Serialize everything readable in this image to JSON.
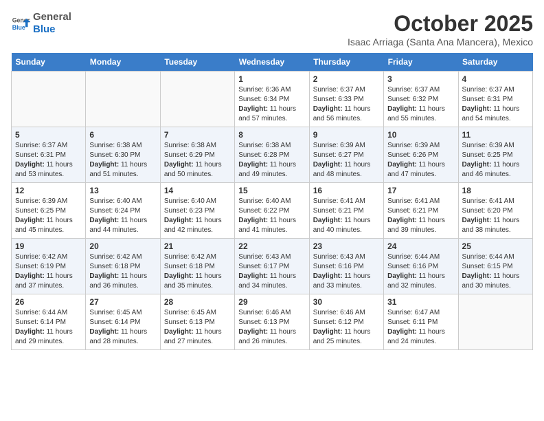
{
  "header": {
    "logo_line1": "General",
    "logo_line2": "Blue",
    "month": "October 2025",
    "location": "Isaac Arriaga (Santa Ana Mancera), Mexico"
  },
  "days_of_week": [
    "Sunday",
    "Monday",
    "Tuesday",
    "Wednesday",
    "Thursday",
    "Friday",
    "Saturday"
  ],
  "weeks": [
    [
      {
        "day": "",
        "content": ""
      },
      {
        "day": "",
        "content": ""
      },
      {
        "day": "",
        "content": ""
      },
      {
        "day": "1",
        "content": "Sunrise: 6:36 AM\nSunset: 6:34 PM\nDaylight: 11 hours and 57 minutes."
      },
      {
        "day": "2",
        "content": "Sunrise: 6:37 AM\nSunset: 6:33 PM\nDaylight: 11 hours and 56 minutes."
      },
      {
        "day": "3",
        "content": "Sunrise: 6:37 AM\nSunset: 6:32 PM\nDaylight: 11 hours and 55 minutes."
      },
      {
        "day": "4",
        "content": "Sunrise: 6:37 AM\nSunset: 6:31 PM\nDaylight: 11 hours and 54 minutes."
      }
    ],
    [
      {
        "day": "5",
        "content": "Sunrise: 6:37 AM\nSunset: 6:31 PM\nDaylight: 11 hours and 53 minutes."
      },
      {
        "day": "6",
        "content": "Sunrise: 6:38 AM\nSunset: 6:30 PM\nDaylight: 11 hours and 51 minutes."
      },
      {
        "day": "7",
        "content": "Sunrise: 6:38 AM\nSunset: 6:29 PM\nDaylight: 11 hours and 50 minutes."
      },
      {
        "day": "8",
        "content": "Sunrise: 6:38 AM\nSunset: 6:28 PM\nDaylight: 11 hours and 49 minutes."
      },
      {
        "day": "9",
        "content": "Sunrise: 6:39 AM\nSunset: 6:27 PM\nDaylight: 11 hours and 48 minutes."
      },
      {
        "day": "10",
        "content": "Sunrise: 6:39 AM\nSunset: 6:26 PM\nDaylight: 11 hours and 47 minutes."
      },
      {
        "day": "11",
        "content": "Sunrise: 6:39 AM\nSunset: 6:25 PM\nDaylight: 11 hours and 46 minutes."
      }
    ],
    [
      {
        "day": "12",
        "content": "Sunrise: 6:39 AM\nSunset: 6:25 PM\nDaylight: 11 hours and 45 minutes."
      },
      {
        "day": "13",
        "content": "Sunrise: 6:40 AM\nSunset: 6:24 PM\nDaylight: 11 hours and 44 minutes."
      },
      {
        "day": "14",
        "content": "Sunrise: 6:40 AM\nSunset: 6:23 PM\nDaylight: 11 hours and 42 minutes."
      },
      {
        "day": "15",
        "content": "Sunrise: 6:40 AM\nSunset: 6:22 PM\nDaylight: 11 hours and 41 minutes."
      },
      {
        "day": "16",
        "content": "Sunrise: 6:41 AM\nSunset: 6:21 PM\nDaylight: 11 hours and 40 minutes."
      },
      {
        "day": "17",
        "content": "Sunrise: 6:41 AM\nSunset: 6:21 PM\nDaylight: 11 hours and 39 minutes."
      },
      {
        "day": "18",
        "content": "Sunrise: 6:41 AM\nSunset: 6:20 PM\nDaylight: 11 hours and 38 minutes."
      }
    ],
    [
      {
        "day": "19",
        "content": "Sunrise: 6:42 AM\nSunset: 6:19 PM\nDaylight: 11 hours and 37 minutes."
      },
      {
        "day": "20",
        "content": "Sunrise: 6:42 AM\nSunset: 6:18 PM\nDaylight: 11 hours and 36 minutes."
      },
      {
        "day": "21",
        "content": "Sunrise: 6:42 AM\nSunset: 6:18 PM\nDaylight: 11 hours and 35 minutes."
      },
      {
        "day": "22",
        "content": "Sunrise: 6:43 AM\nSunset: 6:17 PM\nDaylight: 11 hours and 34 minutes."
      },
      {
        "day": "23",
        "content": "Sunrise: 6:43 AM\nSunset: 6:16 PM\nDaylight: 11 hours and 33 minutes."
      },
      {
        "day": "24",
        "content": "Sunrise: 6:44 AM\nSunset: 6:16 PM\nDaylight: 11 hours and 32 minutes."
      },
      {
        "day": "25",
        "content": "Sunrise: 6:44 AM\nSunset: 6:15 PM\nDaylight: 11 hours and 30 minutes."
      }
    ],
    [
      {
        "day": "26",
        "content": "Sunrise: 6:44 AM\nSunset: 6:14 PM\nDaylight: 11 hours and 29 minutes."
      },
      {
        "day": "27",
        "content": "Sunrise: 6:45 AM\nSunset: 6:14 PM\nDaylight: 11 hours and 28 minutes."
      },
      {
        "day": "28",
        "content": "Sunrise: 6:45 AM\nSunset: 6:13 PM\nDaylight: 11 hours and 27 minutes."
      },
      {
        "day": "29",
        "content": "Sunrise: 6:46 AM\nSunset: 6:13 PM\nDaylight: 11 hours and 26 minutes."
      },
      {
        "day": "30",
        "content": "Sunrise: 6:46 AM\nSunset: 6:12 PM\nDaylight: 11 hours and 25 minutes."
      },
      {
        "day": "31",
        "content": "Sunrise: 6:47 AM\nSunset: 6:11 PM\nDaylight: 11 hours and 24 minutes."
      },
      {
        "day": "",
        "content": ""
      }
    ]
  ]
}
